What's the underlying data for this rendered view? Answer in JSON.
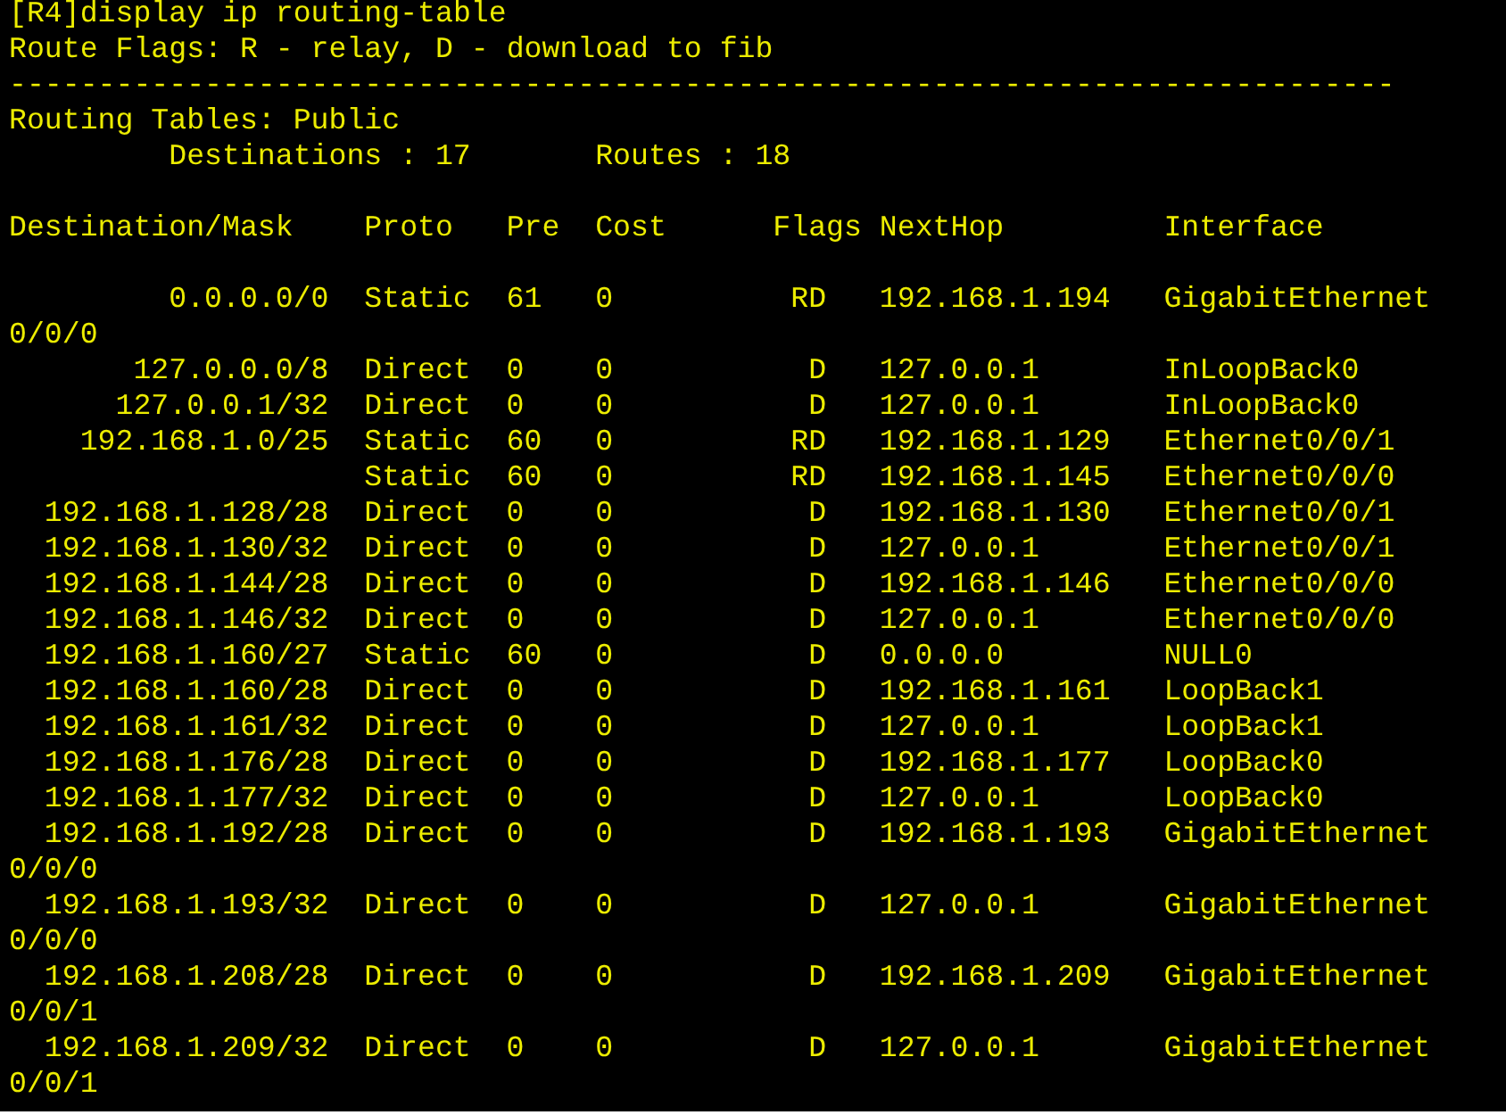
{
  "command": {
    "prompt": "[R4]",
    "text": "display ip routing-table"
  },
  "flags_legend": "Route Flags: R - relay, D - download to fib",
  "separator": "------------------------------------------------------------------------------",
  "table_title": "Routing Tables: Public",
  "summary": {
    "destinations": "Destinations : 17",
    "routes": "Routes : 18"
  },
  "columns": [
    "Destination/Mask",
    "Proto",
    "Pre",
    "Cost",
    "Flags",
    "NextHop",
    "Interface"
  ],
  "rows": [
    {
      "destination": "0.0.0.0/0",
      "proto": "Static",
      "pre": "61",
      "cost": "0",
      "flags": "RD",
      "nexthop": "192.168.1.194",
      "interface": "GigabitEthernet",
      "wrap": "0/0/0"
    },
    {
      "destination": "127.0.0.0/8",
      "proto": "Direct",
      "pre": "0",
      "cost": "0",
      "flags": "D",
      "nexthop": "127.0.0.1",
      "interface": "InLoopBack0"
    },
    {
      "destination": "127.0.0.1/32",
      "proto": "Direct",
      "pre": "0",
      "cost": "0",
      "flags": "D",
      "nexthop": "127.0.0.1",
      "interface": "InLoopBack0"
    },
    {
      "destination": "192.168.1.0/25",
      "proto": "Static",
      "pre": "60",
      "cost": "0",
      "flags": "RD",
      "nexthop": "192.168.1.129",
      "interface": "Ethernet0/0/1"
    },
    {
      "proto": "Static",
      "pre": "60",
      "cost": "0",
      "flags": "RD",
      "nexthop": "192.168.1.145",
      "interface": "Ethernet0/0/0"
    },
    {
      "destination": "192.168.1.128/28",
      "proto": "Direct",
      "pre": "0",
      "cost": "0",
      "flags": "D",
      "nexthop": "192.168.1.130",
      "interface": "Ethernet0/0/1"
    },
    {
      "destination": "192.168.1.130/32",
      "proto": "Direct",
      "pre": "0",
      "cost": "0",
      "flags": "D",
      "nexthop": "127.0.0.1",
      "interface": "Ethernet0/0/1"
    },
    {
      "destination": "192.168.1.144/28",
      "proto": "Direct",
      "pre": "0",
      "cost": "0",
      "flags": "D",
      "nexthop": "192.168.1.146",
      "interface": "Ethernet0/0/0"
    },
    {
      "destination": "192.168.1.146/32",
      "proto": "Direct",
      "pre": "0",
      "cost": "0",
      "flags": "D",
      "nexthop": "127.0.0.1",
      "interface": "Ethernet0/0/0"
    },
    {
      "destination": "192.168.1.160/27",
      "proto": "Static",
      "pre": "60",
      "cost": "0",
      "flags": "D",
      "nexthop": "0.0.0.0",
      "interface": "NULL0"
    },
    {
      "destination": "192.168.1.160/28",
      "proto": "Direct",
      "pre": "0",
      "cost": "0",
      "flags": "D",
      "nexthop": "192.168.1.161",
      "interface": "LoopBack1"
    },
    {
      "destination": "192.168.1.161/32",
      "proto": "Direct",
      "pre": "0",
      "cost": "0",
      "flags": "D",
      "nexthop": "127.0.0.1",
      "interface": "LoopBack1"
    },
    {
      "destination": "192.168.1.176/28",
      "proto": "Direct",
      "pre": "0",
      "cost": "0",
      "flags": "D",
      "nexthop": "192.168.1.177",
      "interface": "LoopBack0"
    },
    {
      "destination": "192.168.1.177/32",
      "proto": "Direct",
      "pre": "0",
      "cost": "0",
      "flags": "D",
      "nexthop": "127.0.0.1",
      "interface": "LoopBack0"
    },
    {
      "destination": "192.168.1.192/28",
      "proto": "Direct",
      "pre": "0",
      "cost": "0",
      "flags": "D",
      "nexthop": "192.168.1.193",
      "interface": "GigabitEthernet",
      "wrap": "0/0/0"
    },
    {
      "destination": "192.168.1.193/32",
      "proto": "Direct",
      "pre": "0",
      "cost": "0",
      "flags": "D",
      "nexthop": "127.0.0.1",
      "interface": "GigabitEthernet",
      "wrap": "0/0/0"
    },
    {
      "destination": "192.168.1.208/28",
      "proto": "Direct",
      "pre": "0",
      "cost": "0",
      "flags": "D",
      "nexthop": "192.168.1.209",
      "interface": "GigabitEthernet",
      "wrap": "0/0/1"
    },
    {
      "destination": "192.168.1.209/32",
      "proto": "Direct",
      "pre": "0",
      "cost": "0",
      "flags": "D",
      "nexthop": "127.0.0.1",
      "interface": "GigabitEthernet",
      "wrap": "0/0/1"
    }
  ]
}
